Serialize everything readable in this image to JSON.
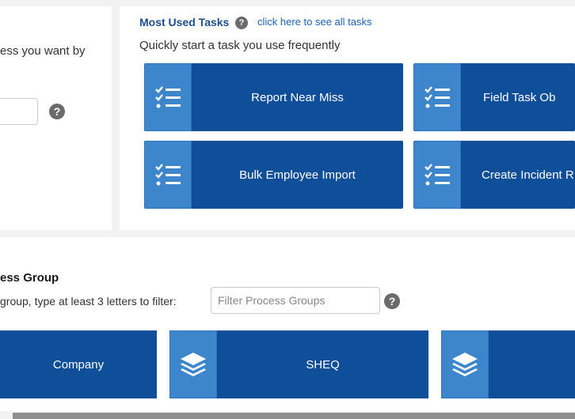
{
  "left_panel": {
    "text": "ess you want by",
    "help": "?"
  },
  "most_used": {
    "title": "Most Used Tasks",
    "help": "?",
    "link": "click here to see all tasks",
    "subtitle": "Quickly start a task you use frequently",
    "tasks": [
      {
        "label": "Report Near Miss",
        "icon": "checklist-icon"
      },
      {
        "label": "Field Task Ob",
        "icon": "checklist-icon"
      },
      {
        "label": "Bulk Employee Import",
        "icon": "checklist-icon"
      },
      {
        "label": "Create Incident R",
        "icon": "checklist-icon"
      }
    ]
  },
  "process_group": {
    "title": "ess Group",
    "hint": "group, type at least 3 letters to filter:",
    "filter_placeholder": "Filter Process Groups",
    "help": "?",
    "groups": [
      {
        "label": "Company",
        "icon": "layers-icon"
      },
      {
        "label": "SHEQ",
        "icon": "layers-icon"
      },
      {
        "label": "",
        "icon": "layers-icon"
      }
    ]
  },
  "colors": {
    "tile_dark": "#0f4f99",
    "tile_light": "#3d86cc",
    "title_blue": "#1f4e8c",
    "link_blue": "#1f63b4"
  }
}
